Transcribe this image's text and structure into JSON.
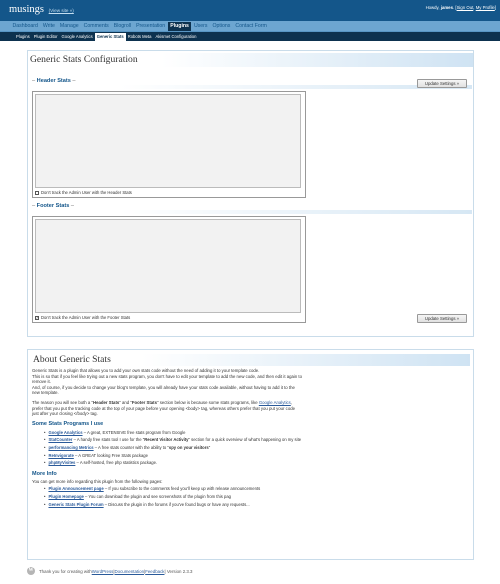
{
  "header": {
    "site_title": "musings",
    "view_site": "(View site »)",
    "howdy": "Howdy,",
    "username": "james",
    "sign_out": "Sign Out",
    "my_profile": "My Profile"
  },
  "menu": [
    {
      "label": "Dashboard"
    },
    {
      "label": "Write"
    },
    {
      "label": "Manage"
    },
    {
      "label": "Comments"
    },
    {
      "label": "Blogroll"
    },
    {
      "label": "Presentation"
    },
    {
      "label": "Plugins",
      "current": true
    },
    {
      "label": "Users"
    },
    {
      "label": "Options"
    },
    {
      "label": "Contact Form"
    }
  ],
  "submenu": [
    {
      "label": "Plugins"
    },
    {
      "label": "Plugin Editor"
    },
    {
      "label": "Google Analytics"
    },
    {
      "label": "Generic Stats",
      "current": true
    },
    {
      "label": "Robots Meta"
    },
    {
      "label": "Akismet Configuration"
    }
  ],
  "config": {
    "title": "Generic Stats Configuration",
    "header_section": {
      "label": "Header Stats",
      "code": "",
      "checkbox_label": "Don't track the Admin User with the Header Stats",
      "checked": false
    },
    "footer_section": {
      "label": "Footer Stats",
      "code": "",
      "checkbox_label": "Don't track the Admin User with the Footer Stats",
      "checked": true
    },
    "update_button": "Update Settings »"
  },
  "about": {
    "title": "About Generic Stats",
    "intro_1": "Generic Stats is a plugin that allows you to add your own stats code without the need of adding it to your template code.",
    "intro_2": "This is so that if you feel like trying out a new stats program, you don't have to edit your template to add the new code, and then edit it again to remove it.",
    "intro_3": "And, of course, if you decide to change your blog's template, you will already have your stats code available, without having to add it to the new template.",
    "reason_pre": "The reason you will see both a \"",
    "reason_header": "Header Stats",
    "reason_mid1": "\" and \"",
    "reason_footer": "Footer Stats",
    "reason_mid2": "\" section below is because some stats programs, like ",
    "reason_link": "Google Analytics",
    "reason_post": ", prefer that you put the tracking code at the top of your page before your opening <body> tag, whereas others prefer that you put your code just after your closing </body> tag.",
    "programs_heading": "Some Stats Programs I use",
    "programs": [
      {
        "name": "Google Analytics",
        "pre": " – A great, EXTENSIVE free stats program from Google",
        "bold": "",
        "post": ""
      },
      {
        "name": "StatCounter",
        "pre": " – A handy free stats tool I use for the \"",
        "bold": "Recent Visitor Activity",
        "post": "\" section for a quick overview of what's happening on my site"
      },
      {
        "name": "performancing Metrics",
        "pre": " – A free stats counter with the ability to \"",
        "bold": "spy on your visitors",
        "post": "\""
      },
      {
        "name": "ReInvigorate",
        "pre": " – A GREAT looking Free Stats package",
        "bold": "",
        "post": ""
      },
      {
        "name": "phpMyVisites",
        "pre": " – A self-hosted, free php statistics package.",
        "bold": "",
        "post": ""
      }
    ],
    "more_heading": "More Info",
    "more_intro": "You can get more info regarding this plugin from the following pages:",
    "more_links": [
      {
        "name": "Plugin Announcement page",
        "desc": " – If you subscribe to the comments feed you'll keep up with release announcements"
      },
      {
        "name": "Plugin Homepage",
        "desc": " – You can download the plugin and see screenshots of the plugin from this pag"
      },
      {
        "name": "Generic Stats Plugin Forum",
        "desc": " – Discuss the plugin in the forums if you've found bugs or have any requests..."
      }
    ]
  },
  "footer": {
    "logo_letter": "W",
    "thanks": "Thank you for creating with ",
    "wordpress": "WordPress",
    "sep1": " | ",
    "documentation": "Documentation",
    "sep2": " | ",
    "feedback": "Feedback",
    "version": " | Version 2.3.3"
  }
}
